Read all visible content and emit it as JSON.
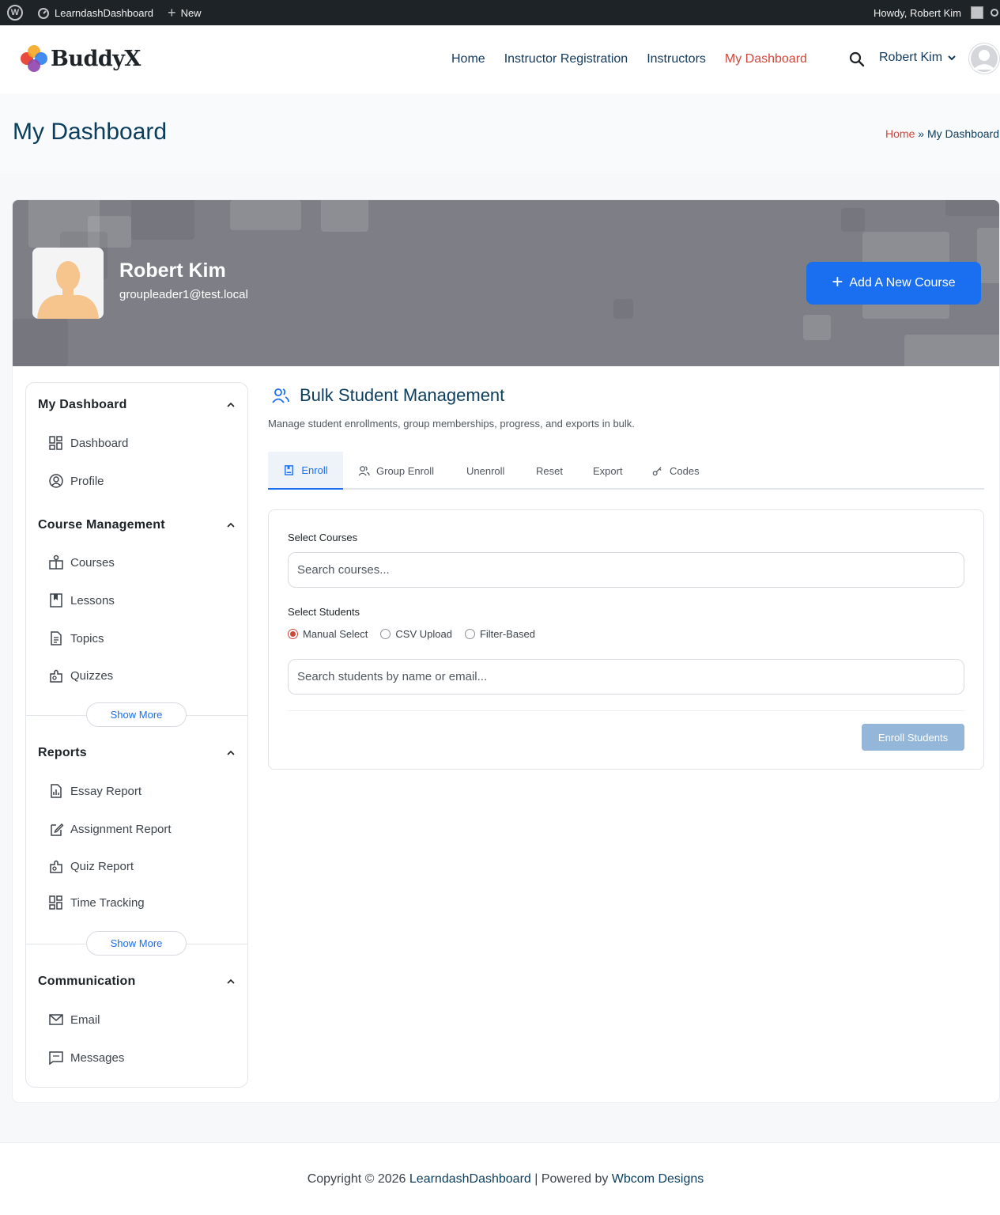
{
  "admin_bar": {
    "site_name": "LearndashDashboard",
    "new_label": "New",
    "howdy": "Howdy, Robert Kim"
  },
  "header": {
    "logo_text": "BuddyX",
    "nav": [
      {
        "label": "Home"
      },
      {
        "label": "Instructor Registration"
      },
      {
        "label": "Instructors"
      },
      {
        "label": "My Dashboard",
        "active": true
      }
    ],
    "user_name": "Robert Kim"
  },
  "page": {
    "title": "My Dashboard",
    "breadcrumb_home": "Home",
    "breadcrumb_sep": "»",
    "breadcrumb_current": "My Dashboard"
  },
  "profile": {
    "name": "Robert Kim",
    "email": "groupleader1@test.local",
    "add_course_label": "Add A New Course"
  },
  "sidebar": {
    "sections": [
      {
        "title": "My Dashboard",
        "items": [
          {
            "label": "Dashboard",
            "icon": "dashboard-icon"
          },
          {
            "label": "Profile",
            "icon": "profile-icon"
          }
        ]
      },
      {
        "title": "Course Management",
        "items": [
          {
            "label": "Courses",
            "icon": "courses-icon"
          },
          {
            "label": "Lessons",
            "icon": "lessons-icon"
          },
          {
            "label": "Topics",
            "icon": "topics-icon"
          },
          {
            "label": "Quizzes",
            "icon": "quizzes-icon"
          }
        ],
        "show_more": "Show More"
      },
      {
        "title": "Reports",
        "items": [
          {
            "label": "Essay Report",
            "icon": "essay-report-icon"
          },
          {
            "label": "Assignment Report",
            "icon": "assignment-report-icon"
          },
          {
            "label": "Quiz Report",
            "icon": "quiz-report-icon"
          },
          {
            "label": "Time Tracking",
            "icon": "time-tracking-icon"
          }
        ],
        "show_more": "Show More"
      },
      {
        "title": "Communication",
        "items": [
          {
            "label": "Email",
            "icon": "email-icon"
          },
          {
            "label": "Messages",
            "icon": "messages-icon"
          }
        ]
      }
    ]
  },
  "content": {
    "title": "Bulk Student Management",
    "subtitle": "Manage student enrollments, group memberships, progress, and exports in bulk.",
    "tabs": [
      {
        "label": "Enroll",
        "active": true
      },
      {
        "label": "Group Enroll"
      },
      {
        "label": "Unenroll"
      },
      {
        "label": "Reset"
      },
      {
        "label": "Export"
      },
      {
        "label": "Codes"
      }
    ],
    "form": {
      "courses_label": "Select Courses",
      "courses_placeholder": "Search courses...",
      "students_label": "Select Students",
      "modes": [
        {
          "label": "Manual Select",
          "checked": true
        },
        {
          "label": "CSV Upload",
          "checked": false
        },
        {
          "label": "Filter-Based",
          "checked": false
        }
      ],
      "students_placeholder": "Search students by name or email...",
      "submit_label": "Enroll Students"
    }
  },
  "footer": {
    "prefix": "Copyright © 2026",
    "site_link": "LearndashDashboard",
    "middle": "| Powered by",
    "company_link": "Wbcom Designs"
  },
  "colors": {
    "accent": "#1a6ef0",
    "active_nav": "#d0473b",
    "title": "#0b3d5c"
  }
}
